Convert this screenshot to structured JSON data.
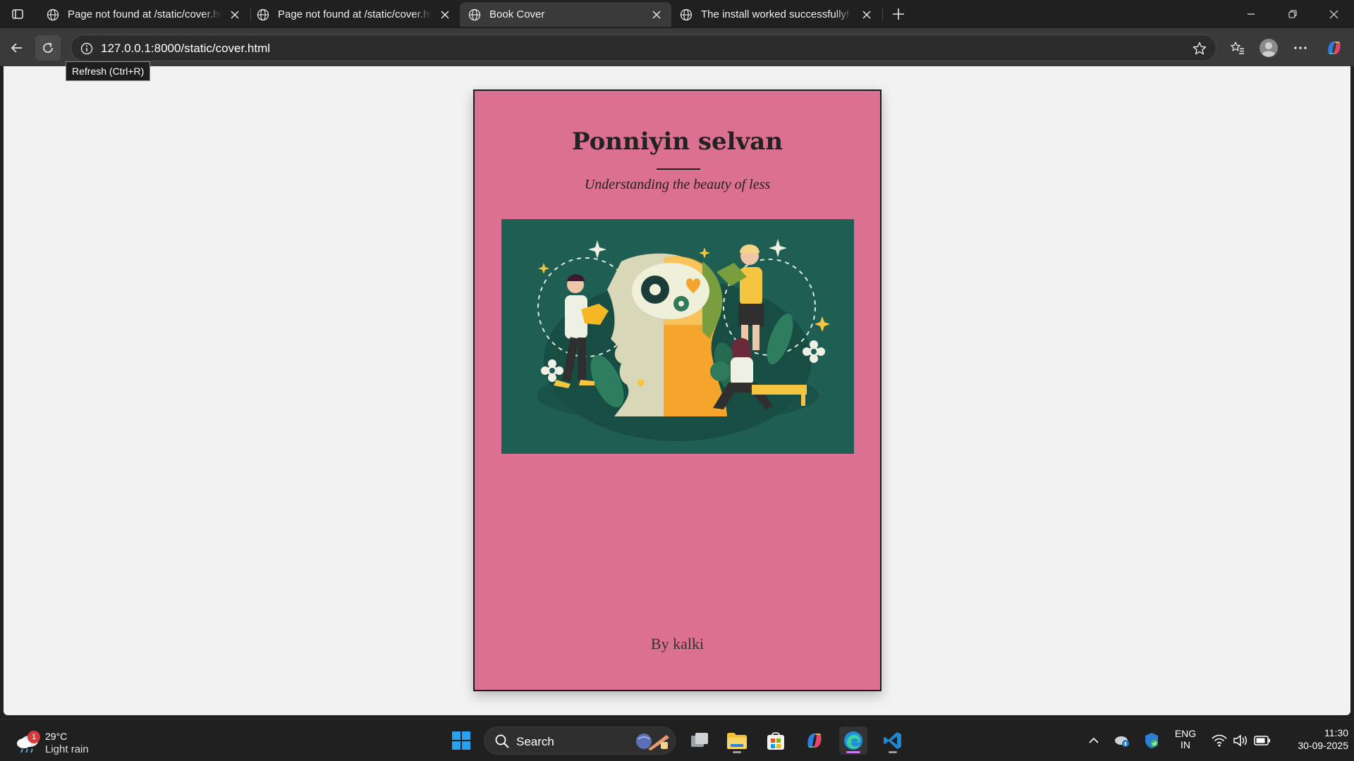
{
  "browser": {
    "tabs": [
      {
        "title": "Page not found at /static/cover.html",
        "active": false
      },
      {
        "title": "Page not found at /static/cover.html",
        "active": false
      },
      {
        "title": "Book Cover",
        "active": true
      },
      {
        "title": "The install worked successfully! Congratulations!",
        "active": false
      }
    ],
    "address": "127.0.0.1:8000/static/cover.html",
    "tooltip": "Refresh (Ctrl+R)"
  },
  "cover": {
    "title": "Ponniyin selvan",
    "subtitle": "Understanding the beauty of less",
    "author": "By kalki",
    "background": "#dc7093",
    "art_background": "#1f5e52"
  },
  "taskbar": {
    "weather": {
      "temp": "29°C",
      "condition": "Light rain",
      "badge": "1"
    },
    "search_label": "Search",
    "language": {
      "line1": "ENG",
      "line2": "IN"
    },
    "clock": {
      "time": "11:30",
      "date": "30-09-2025"
    }
  },
  "colors": {
    "edge_blue": "#1e90d6",
    "vscode_blue": "#1f8ad2",
    "windows_blue": "#2aa0f0",
    "folder_yellow": "#f3c03a"
  }
}
